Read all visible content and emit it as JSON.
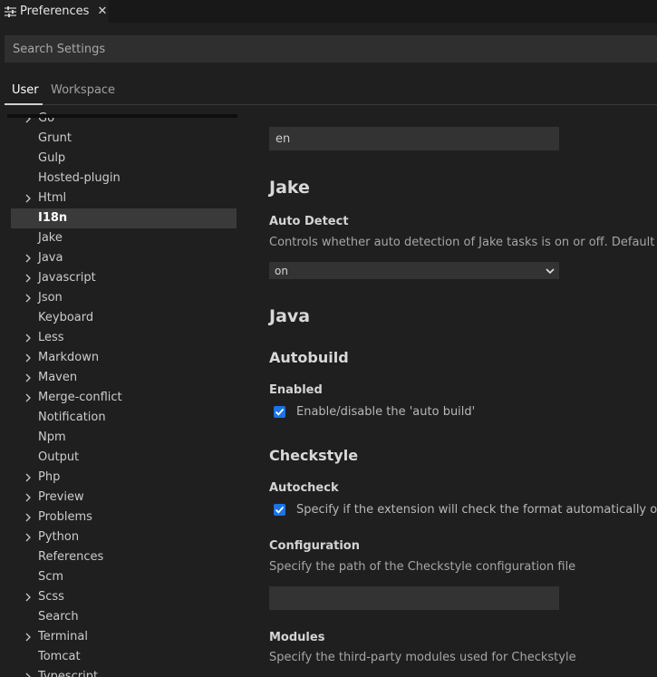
{
  "tab": {
    "label": "Preferences",
    "close": "✕"
  },
  "search": {
    "placeholder": "Search Settings"
  },
  "scopes": {
    "user": "User",
    "workspace": "Workspace"
  },
  "tree": [
    {
      "label": "Go",
      "expandable": true
    },
    {
      "label": "Grunt",
      "expandable": false
    },
    {
      "label": "Gulp",
      "expandable": false
    },
    {
      "label": "Hosted-plugin",
      "expandable": false
    },
    {
      "label": "Html",
      "expandable": true
    },
    {
      "label": "I18n",
      "expandable": false,
      "selected": true
    },
    {
      "label": "Jake",
      "expandable": false
    },
    {
      "label": "Java",
      "expandable": true
    },
    {
      "label": "Javascript",
      "expandable": true
    },
    {
      "label": "Json",
      "expandable": true
    },
    {
      "label": "Keyboard",
      "expandable": false
    },
    {
      "label": "Less",
      "expandable": true
    },
    {
      "label": "Markdown",
      "expandable": true
    },
    {
      "label": "Maven",
      "expandable": true
    },
    {
      "label": "Merge-conflict",
      "expandable": true
    },
    {
      "label": "Notification",
      "expandable": false
    },
    {
      "label": "Npm",
      "expandable": false
    },
    {
      "label": "Output",
      "expandable": false
    },
    {
      "label": "Php",
      "expandable": true
    },
    {
      "label": "Preview",
      "expandable": true
    },
    {
      "label": "Problems",
      "expandable": true
    },
    {
      "label": "Python",
      "expandable": true
    },
    {
      "label": "References",
      "expandable": false
    },
    {
      "label": "Scm",
      "expandable": false
    },
    {
      "label": "Scss",
      "expandable": true
    },
    {
      "label": "Search",
      "expandable": false
    },
    {
      "label": "Terminal",
      "expandable": true
    },
    {
      "label": "Tomcat",
      "expandable": false
    },
    {
      "label": "Typescript",
      "expandable": true
    }
  ],
  "content": {
    "locale_value": "en",
    "jake": {
      "title": "Jake",
      "auto_detect": {
        "label": "Auto Detect",
        "description": "Controls whether auto detection of Jake tasks is on or off. Default is on.",
        "value": "on"
      }
    },
    "java": {
      "title": "Java",
      "autobuild": {
        "title": "Autobuild",
        "enabled": {
          "label": "Enabled",
          "checkbox_label": "Enable/disable the 'auto build'",
          "checked": true
        }
      },
      "checkstyle": {
        "title": "Checkstyle",
        "autocheck": {
          "label": "Autocheck",
          "checkbox_label": "Specify if the extension will check the format automatically or not",
          "checked": true
        },
        "configuration": {
          "label": "Configuration",
          "description": "Specify the path of the Checkstyle configuration file",
          "value": ""
        },
        "modules": {
          "label": "Modules",
          "description": "Specify the third-party modules used for Checkstyle"
        }
      }
    }
  }
}
